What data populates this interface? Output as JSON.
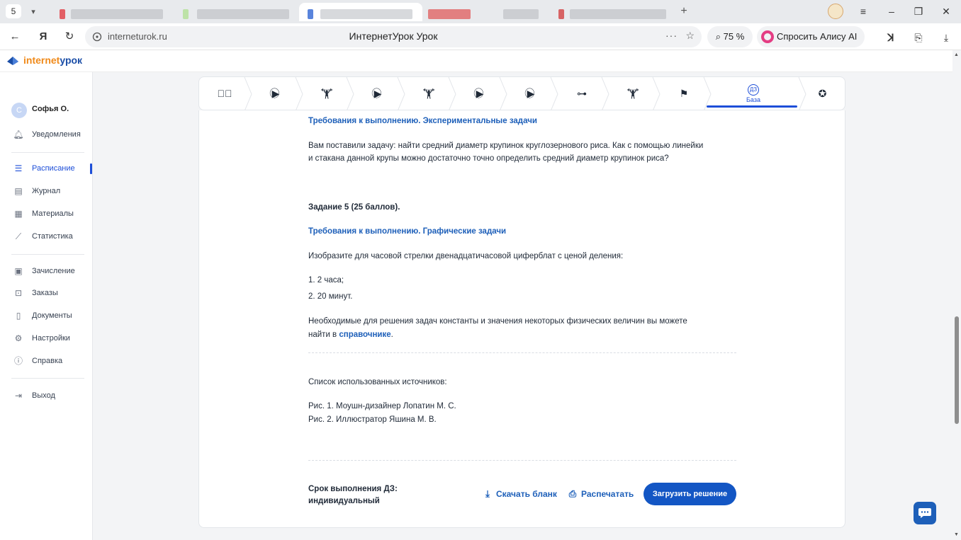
{
  "browser": {
    "tab_count": "5",
    "new_tab_icon": "plus-icon",
    "url": "interneturok.ru",
    "page_title": "ИнтернетУрок Урок",
    "zoom": "75 %",
    "alisa_label": "Спросить Алису AI"
  },
  "site": {
    "logo_part1": "internet",
    "logo_part2": "урок",
    "brand_orange": "#f08a1a",
    "brand_blue": "#1b4ea7"
  },
  "sidebar": {
    "user_initial": "С",
    "user_name": "Софья О.",
    "items": [
      {
        "label": "Уведомления",
        "icon": "bell-icon"
      },
      {
        "label": "Расписание",
        "icon": "list-icon"
      },
      {
        "label": "Журнал",
        "icon": "journal-icon"
      },
      {
        "label": "Материалы",
        "icon": "materials-icon"
      },
      {
        "label": "Статистика",
        "icon": "chart-icon"
      },
      {
        "label": "Зачисление",
        "icon": "enroll-icon"
      },
      {
        "label": "Заказы",
        "icon": "cart-icon"
      },
      {
        "label": "Документы",
        "icon": "document-icon"
      },
      {
        "label": "Настройки",
        "icon": "gear-icon"
      },
      {
        "label": "Справка",
        "icon": "help-icon"
      },
      {
        "label": "Выход",
        "icon": "logout-icon"
      }
    ],
    "active_item": "Расписание"
  },
  "steps": {
    "active_label": "База",
    "active_badge": "ДЗ"
  },
  "content": {
    "req1_title": "Требования к выполнению. Экспериментальные задачи",
    "task4_line1": "Вам поставили задачу: найти средний диаметр крупинок круглозернового риса. Как с помощью линейки",
    "task4_line2": "и стакана данной крупы можно достаточно точно определить средний диаметр крупинок риса?",
    "task5_title": "Задание 5 (25 баллов).",
    "req2_title": "Требования к выполнению. Графические задачи",
    "task5_text": "Изобразите для часовой стрелки двенадцатичасовой циферблат с ценой деления:",
    "item1": "1. 2 часа;",
    "item2": "2. 20 минут.",
    "ref_line1": "Необходимые для решения задач константы и значения некоторых физических величин вы можете",
    "ref_line2_pre": "найти в ",
    "ref_link": "справочнике",
    "ref_line2_post": ".",
    "sources_title": "Список использованных источников:",
    "source1": "Рис. 1. Моушн-дизайнер Лопатин М. С.",
    "source2": "Рис. 2. Иллюстратор Яшина М. В."
  },
  "footer": {
    "deadline_line1": "Срок выполнения ДЗ:",
    "deadline_line2": "индивидуальный",
    "download_label": "Скачать бланк",
    "print_label": "Распечатать",
    "upload_label": "Загрузить решение"
  }
}
